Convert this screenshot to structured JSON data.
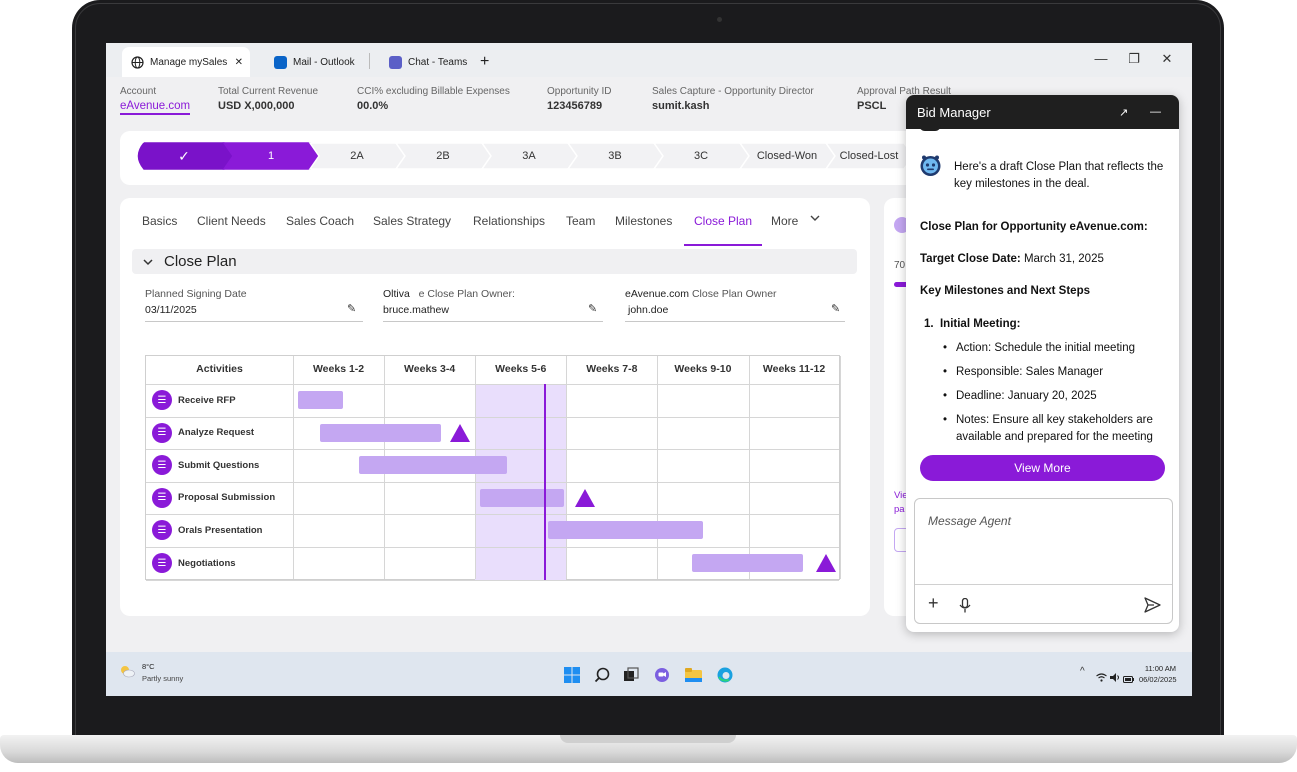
{
  "browser": {
    "tabs": [
      {
        "label": "Manage mySales",
        "active": true
      },
      {
        "label": "Mail - Outlook",
        "active": false
      },
      {
        "label": "Chat - Teams",
        "active": false
      }
    ],
    "new_tab": "+",
    "controls": {
      "minimize": "—",
      "restore": "❐",
      "close": "✕"
    },
    "tab_close": "✕"
  },
  "header": {
    "account": {
      "label": "Account",
      "value": "eAvenue.com"
    },
    "revenue": {
      "label": "Total Current Revenue",
      "value": "USD X,000,000"
    },
    "cci": {
      "label": "CCI% excluding Billable Expenses",
      "value": "00.0%"
    },
    "opportunity": {
      "label": "Opportunity ID",
      "value": "123456789"
    },
    "sales_capture": {
      "label": "Sales Capture - Opportunity Director",
      "value": "sumit.kash"
    },
    "approval": {
      "label": "Approval Path Result",
      "value": "PSCL"
    }
  },
  "stages": [
    "✓",
    "1",
    "2A",
    "2B",
    "3A",
    "3B",
    "3C",
    "Closed-Won",
    "Closed-Lost"
  ],
  "nav_tabs": [
    "Basics",
    "Client Needs",
    "Sales Coach",
    "Sales Strategy",
    "Relationships",
    "Team",
    "Milestones",
    "Close Plan",
    "More"
  ],
  "active_tab": "Close Plan",
  "section": {
    "title": "Close Plan",
    "chevron": "⌄"
  },
  "fields": {
    "signing_date": {
      "label": "Planned Signing Date",
      "value": "03/11/2025"
    },
    "oltiva_owner": {
      "label_prefix": "Oltiva",
      "label": "e Close Plan Owner:",
      "value": "bruce.mathew"
    },
    "client_owner": {
      "label_prefix": "eAvenue.com",
      "label": "Close Plan Owner",
      "value": "john.doe"
    }
  },
  "gantt": {
    "activities_header": "Activities",
    "weeks": [
      "Weeks 1-2",
      "Weeks 3-4",
      "Weeks 5-6",
      "Weeks 7-8",
      "Weeks 9-10",
      "Weeks 11-12"
    ],
    "rows": [
      {
        "label": "Receive RFP",
        "start": 0.05,
        "end": 0.55,
        "milestone": null
      },
      {
        "label": "Analyze Request",
        "start": 0.3,
        "end": 1.63,
        "milestone": 1.83
      },
      {
        "label": "Submit Questions",
        "start": 0.72,
        "end": 2.35,
        "milestone": null
      },
      {
        "label": "Proposal Submission",
        "start": 2.05,
        "end": 2.97,
        "milestone": 3.2
      },
      {
        "label": "Orals Presentation",
        "start": 2.8,
        "end": 4.5,
        "milestone": null
      },
      {
        "label": "Negotiations",
        "start": 4.38,
        "end": 5.6,
        "milestone": 5.85
      }
    ],
    "current_week": 2.75,
    "highlight_col": 2,
    "colors": {
      "bar": "#c4a7f2",
      "milestone": "#8a1ad8",
      "highlight": "#e9defc"
    }
  },
  "side_card": {
    "progress_label": "70",
    "link_text_1": "Vie",
    "link_text_2": "pa"
  },
  "taskbar": {
    "weather_temp": "8°C",
    "weather_desc": "Partly sunny",
    "time": "11:00 AM",
    "date": "06/02/2025",
    "tray_chevron": "^"
  },
  "bid_manager": {
    "title": "Bid Manager",
    "expand_icon": "↗",
    "minimize_icon": "—",
    "intro": "Here's a draft Close Plan that reflects the key milestones in the deal.",
    "plan_title_prefix": "Close Plan for Opportunity ",
    "plan_title_account": "eAvenue.com:",
    "target_label": "Target Close Date:",
    "target_value": " March 31, 2025",
    "milestones_heading": "Key Milestones and Next Steps",
    "item_heading": "1.  Initial Meeting:",
    "bullets": [
      "Action: Schedule the initial meeting",
      "Responsible: Sales Manager",
      "Deadline: January 20, 2025",
      "Notes: Ensure all key stakeholders are available and prepared for the meeting"
    ],
    "view_more": "View More",
    "message_placeholder": "Message Agent",
    "add_icon": "+",
    "send_icon": "➤"
  }
}
